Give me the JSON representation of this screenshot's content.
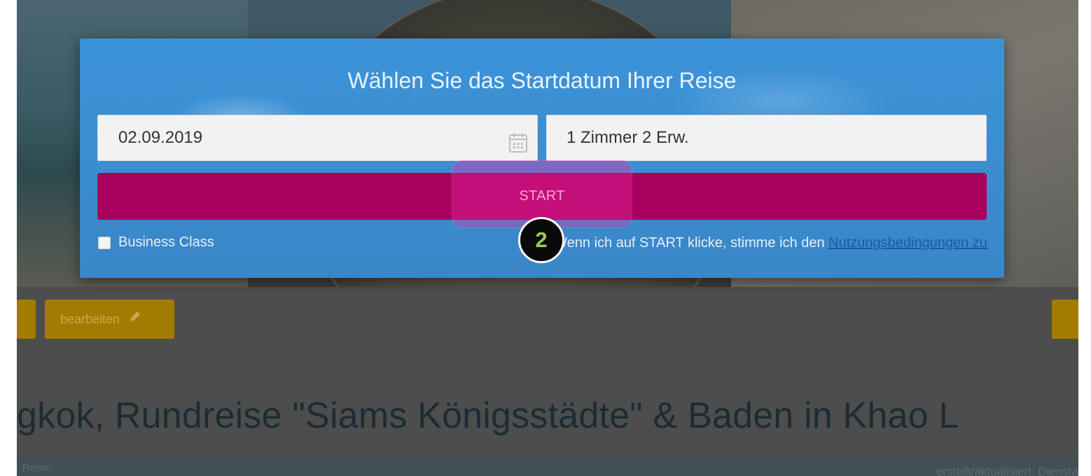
{
  "modal": {
    "title": "Wählen Sie das Startdatum Ihrer Reise",
    "date_value": "02.09.2019",
    "date_icon": "calendar-icon",
    "rooms_value": "1 Zimmer 2 Erw.",
    "start_label": "START",
    "business_class_label": "Business Class",
    "business_class_checked": false,
    "terms_text": "Wenn ich auf START klicke, stimme ich den ",
    "terms_link": "Nutzungsbedingungen zu"
  },
  "background": {
    "edit_button_label": "bearbeiten",
    "edit_icon": "pencil-icon",
    "page_title": "gkok, Rundreise \"Siams Königsstädte\" & Baden in Khao L",
    "info_left": "Reise:",
    "info_right": "erstellt/aktualisiert: Diensta"
  },
  "step_badge": "2",
  "colors": {
    "modal_blue": "#3b8fd3",
    "start_magenta": "#a8005e",
    "badge_green": "#99c959",
    "edit_button_gold": "#a27c00"
  }
}
